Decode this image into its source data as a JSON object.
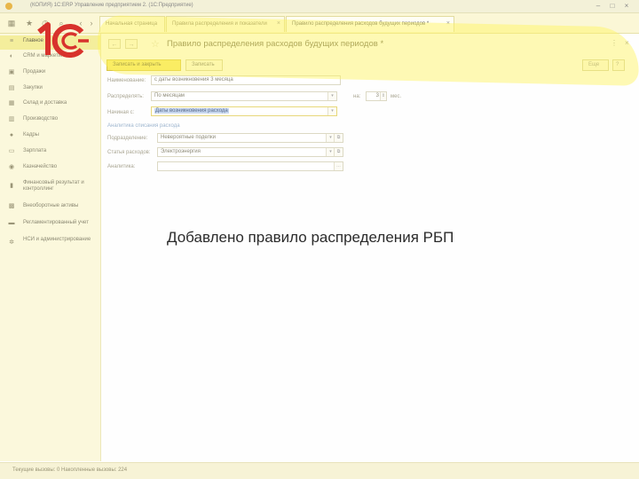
{
  "window": {
    "title": "(КОПИЯ) 1С:ERP Управление предприятием 2. (1С:Предприятие)"
  },
  "tabs": [
    {
      "label": "Начальная страница",
      "closable": false
    },
    {
      "label": "Правила распределения и показатели",
      "closable": true
    },
    {
      "label": "Правило распределения расходов будущих периодов *",
      "closable": true,
      "active": true
    }
  ],
  "sidebar": {
    "items": [
      {
        "label": "Главное",
        "icon": "menu-icon",
        "active": true
      },
      {
        "label": "CRM и маркетинг",
        "icon": "crm-icon"
      },
      {
        "label": "Продажи",
        "icon": "cart-icon"
      },
      {
        "label": "Закупки",
        "icon": "basket-icon"
      },
      {
        "label": "Склад и доставка",
        "icon": "warehouse-icon"
      },
      {
        "label": "Производство",
        "icon": "factory-icon"
      },
      {
        "label": "Кадры",
        "icon": "person-icon"
      },
      {
        "label": "Зарплата",
        "icon": "salary-icon"
      },
      {
        "label": "Казначейство",
        "icon": "treasury-icon"
      },
      {
        "label": "Финансовый результат и контроллинг",
        "icon": "chart-icon"
      },
      {
        "label": "Внеоборотные активы",
        "icon": "assets-icon"
      },
      {
        "label": "Регламентированный учет",
        "icon": "accounting-icon"
      },
      {
        "label": "НСИ и администрирование",
        "icon": "gear-icon"
      }
    ]
  },
  "document": {
    "title": "Правило распределения расходов будущих периодов *",
    "save_close_label": "Записать и закрыть",
    "save_label": "Записать",
    "more_label": "Еще",
    "help_label": "?",
    "name_label": "Наименование:",
    "name_value": "с даты возникновения 3 месяца",
    "distribute_label": "Распределять:",
    "distribute_value": "По месяцам",
    "for_label": "на:",
    "for_value": "3",
    "months_unit": "мес.",
    "start_label": "Начиная с:",
    "start_value": "Даты возникновения расхода",
    "analytics_section": "Аналитика списания расхода",
    "division_label": "Подразделение:",
    "division_value": "Невероятные поделки",
    "expense_item_label": "Статья расходов:",
    "expense_item_value": "Электроэнергия",
    "analytics_label": "Аналитика:",
    "analytics_value": ""
  },
  "statusbar": {
    "text": "Текущие вызовы: 0   Накопленные вызовы: 224"
  },
  "caption": "Добавлено правило распределения РБП",
  "colors": {
    "accent_yellow": "#f6e76a",
    "sidebar_bg": "#fbf8dc",
    "logo_red": "#d8322c",
    "highlight": "#fff45a"
  }
}
